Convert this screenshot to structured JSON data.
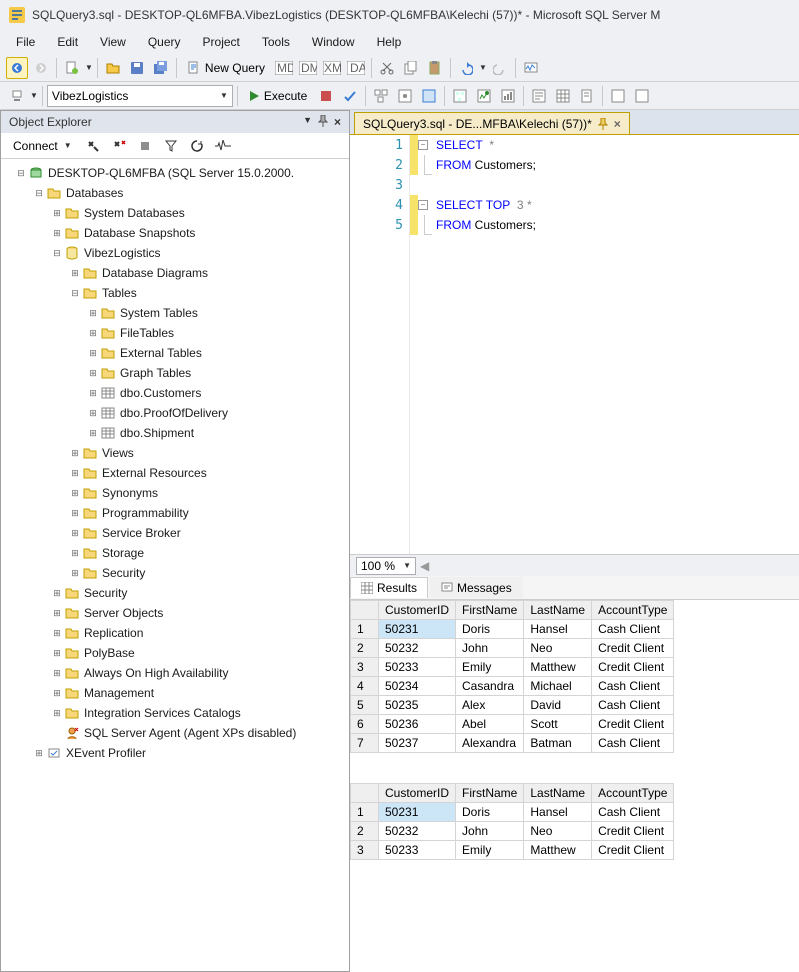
{
  "window_title": "SQLQuery3.sql - DESKTOP-QL6MFBA.VibezLogistics (DESKTOP-QL6MFBA\\Kelechi (57))* - Microsoft SQL Server M",
  "menu": [
    "File",
    "Edit",
    "View",
    "Query",
    "Project",
    "Tools",
    "Window",
    "Help"
  ],
  "toolbar1": {
    "new_query": "New Query"
  },
  "toolbar2": {
    "db_name": "VibezLogistics",
    "execute": "Execute"
  },
  "object_explorer": {
    "title": "Object Explorer",
    "connect_label": "Connect",
    "root": "DESKTOP-QL6MFBA (SQL Server 15.0.2000.",
    "nodes": [
      {
        "level": 2,
        "toggle": "-",
        "icon": "folder",
        "label": "Databases"
      },
      {
        "level": 3,
        "toggle": "+",
        "icon": "folder",
        "label": "System Databases"
      },
      {
        "level": 3,
        "toggle": "+",
        "icon": "folder",
        "label": "Database Snapshots"
      },
      {
        "level": 3,
        "toggle": "-",
        "icon": "db",
        "label": "VibezLogistics"
      },
      {
        "level": 4,
        "toggle": "+",
        "icon": "folder",
        "label": "Database Diagrams"
      },
      {
        "level": 4,
        "toggle": "-",
        "icon": "folder",
        "label": "Tables"
      },
      {
        "level": 5,
        "toggle": "+",
        "icon": "folder",
        "label": "System Tables"
      },
      {
        "level": 5,
        "toggle": "+",
        "icon": "folder",
        "label": "FileTables"
      },
      {
        "level": 5,
        "toggle": "+",
        "icon": "folder",
        "label": "External Tables"
      },
      {
        "level": 5,
        "toggle": "+",
        "icon": "folder",
        "label": "Graph Tables"
      },
      {
        "level": 5,
        "toggle": "+",
        "icon": "table",
        "label": "dbo.Customers"
      },
      {
        "level": 5,
        "toggle": "+",
        "icon": "table",
        "label": "dbo.ProofOfDelivery"
      },
      {
        "level": 5,
        "toggle": "+",
        "icon": "table",
        "label": "dbo.Shipment"
      },
      {
        "level": 4,
        "toggle": "+",
        "icon": "folder",
        "label": "Views"
      },
      {
        "level": 4,
        "toggle": "+",
        "icon": "folder",
        "label": "External Resources"
      },
      {
        "level": 4,
        "toggle": "+",
        "icon": "folder",
        "label": "Synonyms"
      },
      {
        "level": 4,
        "toggle": "+",
        "icon": "folder",
        "label": "Programmability"
      },
      {
        "level": 4,
        "toggle": "+",
        "icon": "folder",
        "label": "Service Broker"
      },
      {
        "level": 4,
        "toggle": "+",
        "icon": "folder",
        "label": "Storage"
      },
      {
        "level": 4,
        "toggle": "+",
        "icon": "folder",
        "label": "Security"
      },
      {
        "level": 3,
        "toggle": "+",
        "icon": "folder",
        "label": "Security"
      },
      {
        "level": 3,
        "toggle": "+",
        "icon": "folder",
        "label": "Server Objects"
      },
      {
        "level": 3,
        "toggle": "+",
        "icon": "folder",
        "label": "Replication"
      },
      {
        "level": 3,
        "toggle": "+",
        "icon": "folder",
        "label": "PolyBase"
      },
      {
        "level": 3,
        "toggle": "+",
        "icon": "folder",
        "label": "Always On High Availability"
      },
      {
        "level": 3,
        "toggle": "+",
        "icon": "folder",
        "label": "Management"
      },
      {
        "level": 3,
        "toggle": "+",
        "icon": "folder",
        "label": "Integration Services Catalogs"
      },
      {
        "level": 3,
        "toggle": "",
        "icon": "agent",
        "label": "SQL Server Agent (Agent XPs disabled)"
      },
      {
        "level": 2,
        "toggle": "+",
        "icon": "xevent",
        "label": "XEvent Profiler"
      }
    ]
  },
  "doc_tab": "SQLQuery3.sql - DE...MFBA\\Kelechi (57))*",
  "editor_lines": [
    "1",
    "2",
    "3",
    "4",
    "5"
  ],
  "code": {
    "l1_kw": "SELECT",
    "l1_rest": "  *",
    "l2_kw": "FROM",
    "l2_rest": " Customers;",
    "l4_kw1": "SELECT",
    "l4_kw2": " TOP",
    "l4_rest": "  3 *",
    "l5_kw": "FROM",
    "l5_rest": " Customers;"
  },
  "zoom": "100 %",
  "tabs": {
    "results": "Results",
    "messages": "Messages"
  },
  "grid_headers": [
    "CustomerID",
    "FirstName",
    "LastName",
    "AccountType"
  ],
  "grid1": [
    [
      "50231",
      "Doris",
      "Hansel",
      "Cash Client"
    ],
    [
      "50232",
      "John",
      "Neo",
      "Credit Client"
    ],
    [
      "50233",
      "Emily",
      "Matthew",
      "Credit Client"
    ],
    [
      "50234",
      "Casandra",
      "Michael",
      "Cash Client"
    ],
    [
      "50235",
      "Alex",
      "David",
      "Cash Client"
    ],
    [
      "50236",
      "Abel",
      "Scott",
      "Credit Client"
    ],
    [
      "50237",
      "Alexandra",
      "Batman",
      "Cash Client"
    ]
  ],
  "grid2": [
    [
      "50231",
      "Doris",
      "Hansel",
      "Cash Client"
    ],
    [
      "50232",
      "John",
      "Neo",
      "Credit Client"
    ],
    [
      "50233",
      "Emily",
      "Matthew",
      "Credit Client"
    ]
  ]
}
